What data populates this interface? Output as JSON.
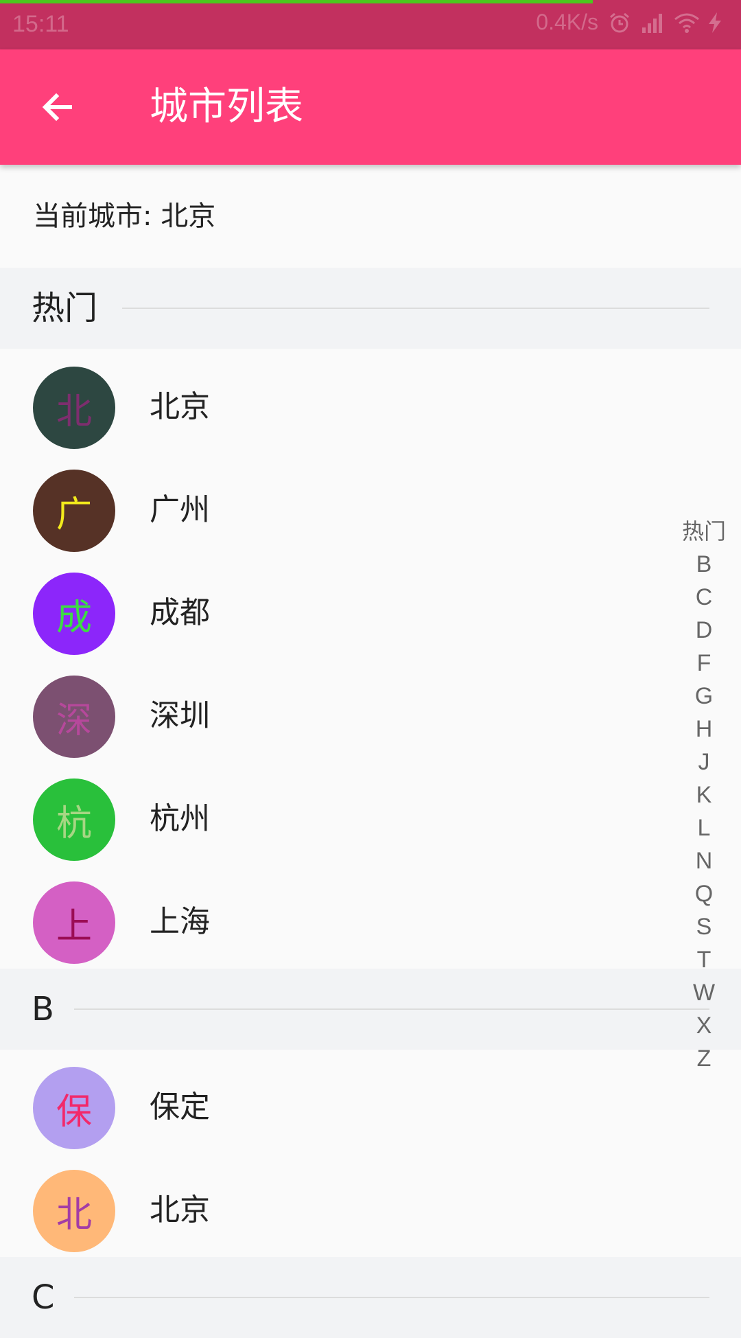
{
  "status_bar": {
    "time": "15:11",
    "speed": "0.4K/s",
    "icons": [
      "alarm-icon",
      "signal-icon",
      "wifi-icon",
      "charging-icon"
    ],
    "download_progress": 0.8
  },
  "toolbar": {
    "back_icon": "arrow-left-icon",
    "title": "城市列表"
  },
  "current_city": {
    "text": "当前城市: 北京"
  },
  "sections": [
    {
      "letter": "热门",
      "cities": [
        {
          "initial": "北",
          "name": "北京",
          "bg": "#2d4741",
          "fg": "#7d2e6e"
        },
        {
          "initial": "广",
          "name": "广州",
          "bg": "#563226",
          "fg": "#f2ea1c"
        },
        {
          "initial": "成",
          "name": "成都",
          "bg": "#8c26fa",
          "fg": "#3ddc44"
        },
        {
          "initial": "深",
          "name": "深圳",
          "bg": "#7c5071",
          "fg": "#b6489b"
        },
        {
          "initial": "杭",
          "name": "杭州",
          "bg": "#29c03b",
          "fg": "#a7d684"
        },
        {
          "initial": "上",
          "name": "上海",
          "bg": "#d460c4",
          "fg": "#9b0d55"
        }
      ]
    },
    {
      "letter": "B",
      "cities": [
        {
          "initial": "保",
          "name": "保定",
          "bg": "#b39ff0",
          "fg": "#f2296a"
        },
        {
          "initial": "北",
          "name": "北京",
          "bg": "#ffb878",
          "fg": "#a33ca6"
        }
      ]
    },
    {
      "letter": "C",
      "cities": []
    }
  ],
  "index_bar": [
    "热门",
    "B",
    "C",
    "D",
    "F",
    "G",
    "H",
    "J",
    "K",
    "L",
    "N",
    "Q",
    "S",
    "T",
    "W",
    "X",
    "Z"
  ],
  "colors": {
    "status_bar": "#c2305f",
    "toolbar": "#ff407b",
    "progress": "#4cc71e",
    "section_bg": "#f2f3f5",
    "page_bg": "#fafafa"
  }
}
